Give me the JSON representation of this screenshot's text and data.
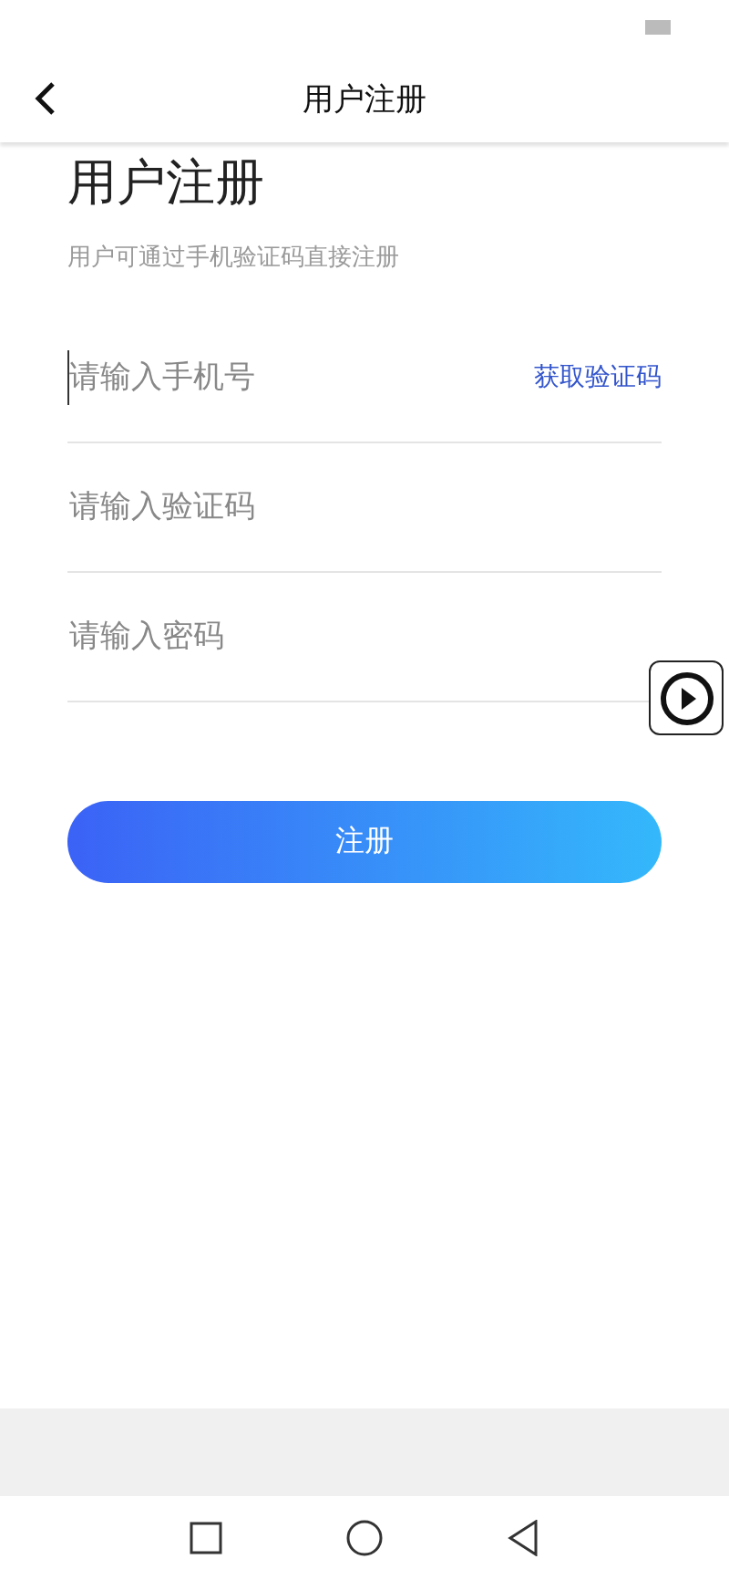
{
  "header": {
    "title": "用户注册"
  },
  "heading": "用户注册",
  "subtitle": "用户可通过手机验证码直接注册",
  "fields": [
    {
      "focused": true,
      "placeholder": "请输入手机号",
      "action": "获取验证码"
    },
    {
      "focused": false,
      "placeholder": "请输入验证码"
    },
    {
      "focused": false,
      "placeholder": "请输入密码"
    }
  ],
  "submit": "注册"
}
